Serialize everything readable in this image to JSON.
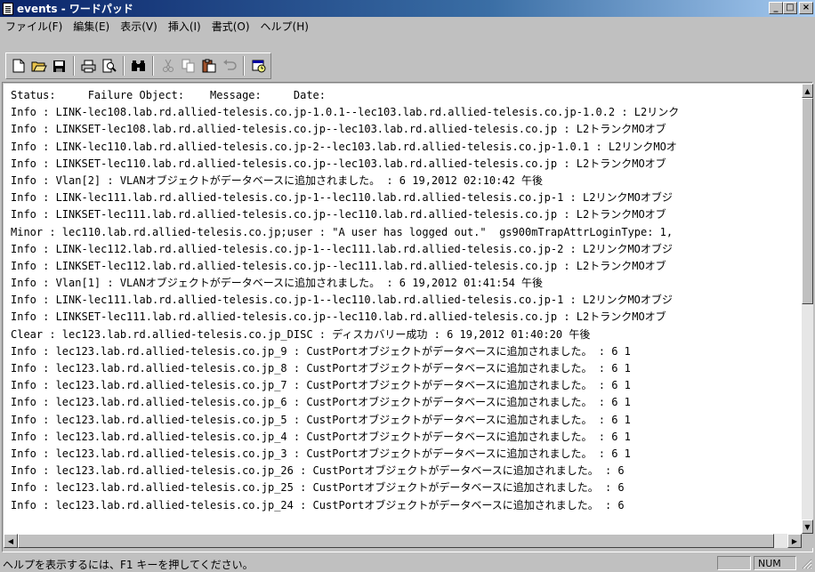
{
  "window": {
    "title": "events - ワードパッド",
    "minimize_label": "_",
    "maximize_label": "□",
    "close_label": "×"
  },
  "menu": [
    "ファイル(F)",
    "編集(E)",
    "表示(V)",
    "挿入(I)",
    "書式(O)",
    "ヘルプ(H)"
  ],
  "toolbar": {
    "icons": [
      "new-icon",
      "open-icon",
      "save-icon",
      "print-icon",
      "print-preview-icon",
      "find-icon",
      "cut-icon",
      "copy-icon",
      "paste-icon",
      "undo-icon",
      "insert-datetime-icon"
    ]
  },
  "document": {
    "lines": [
      "Status:     Failure Object:    Message:     Date:",
      "Info : LINK-lec108.lab.rd.allied-telesis.co.jp-1.0.1--lec103.lab.rd.allied-telesis.co.jp-1.0.2 : L2リンク",
      "Info : LINKSET-lec108.lab.rd.allied-telesis.co.jp--lec103.lab.rd.allied-telesis.co.jp : L2トランクMOオブ",
      "Info : LINK-lec110.lab.rd.allied-telesis.co.jp-2--lec103.lab.rd.allied-telesis.co.jp-1.0.1 : L2リンクMOオ",
      "Info : LINKSET-lec110.lab.rd.allied-telesis.co.jp--lec103.lab.rd.allied-telesis.co.jp : L2トランクMOオブ",
      "Info : Vlan[2] : VLANオブジェクトがデータベースに追加されました。 : 6 19,2012 02:10:42 午後",
      "Info : LINK-lec111.lab.rd.allied-telesis.co.jp-1--lec110.lab.rd.allied-telesis.co.jp-1 : L2リンクMOオブジ",
      "Info : LINKSET-lec111.lab.rd.allied-telesis.co.jp--lec110.lab.rd.allied-telesis.co.jp : L2トランクMOオブ",
      "Minor : lec110.lab.rd.allied-telesis.co.jp;user : \"A user has logged out.\"  gs900mTrapAttrLoginType: 1,",
      "Info : LINK-lec112.lab.rd.allied-telesis.co.jp-1--lec111.lab.rd.allied-telesis.co.jp-2 : L2リンクMOオブジ",
      "Info : LINKSET-lec112.lab.rd.allied-telesis.co.jp--lec111.lab.rd.allied-telesis.co.jp : L2トランクMOオブ",
      "Info : Vlan[1] : VLANオブジェクトがデータベースに追加されました。 : 6 19,2012 01:41:54 午後",
      "Info : LINK-lec111.lab.rd.allied-telesis.co.jp-1--lec110.lab.rd.allied-telesis.co.jp-1 : L2リンクMOオブジ",
      "Info : LINKSET-lec111.lab.rd.allied-telesis.co.jp--lec110.lab.rd.allied-telesis.co.jp : L2トランクMOオブ",
      "Clear : lec123.lab.rd.allied-telesis.co.jp_DISC : ディスカバリー成功 : 6 19,2012 01:40:20 午後",
      "Info : lec123.lab.rd.allied-telesis.co.jp_9 : CustPortオブジェクトがデータベースに追加されました。 : 6 1",
      "Info : lec123.lab.rd.allied-telesis.co.jp_8 : CustPortオブジェクトがデータベースに追加されました。 : 6 1",
      "Info : lec123.lab.rd.allied-telesis.co.jp_7 : CustPortオブジェクトがデータベースに追加されました。 : 6 1",
      "Info : lec123.lab.rd.allied-telesis.co.jp_6 : CustPortオブジェクトがデータベースに追加されました。 : 6 1",
      "Info : lec123.lab.rd.allied-telesis.co.jp_5 : CustPortオブジェクトがデータベースに追加されました。 : 6 1",
      "Info : lec123.lab.rd.allied-telesis.co.jp_4 : CustPortオブジェクトがデータベースに追加されました。 : 6 1",
      "Info : lec123.lab.rd.allied-telesis.co.jp_3 : CustPortオブジェクトがデータベースに追加されました。 : 6 1",
      "Info : lec123.lab.rd.allied-telesis.co.jp_26 : CustPortオブジェクトがデータベースに追加されました。 : 6",
      "Info : lec123.lab.rd.allied-telesis.co.jp_25 : CustPortオブジェクトがデータベースに追加されました。 : 6",
      "Info : lec123.lab.rd.allied-telesis.co.jp_24 : CustPortオブジェクトがデータベースに追加されました。 : 6"
    ]
  },
  "statusbar": {
    "help_text": "ヘルプを表示するには、F1 キーを押してください。",
    "num_label": "NUM"
  },
  "colors": {
    "title_gradient_start": "#0a246a",
    "title_gradient_end": "#a6caf0",
    "face": "#c0c0c0",
    "document_bg": "#ffffff"
  }
}
